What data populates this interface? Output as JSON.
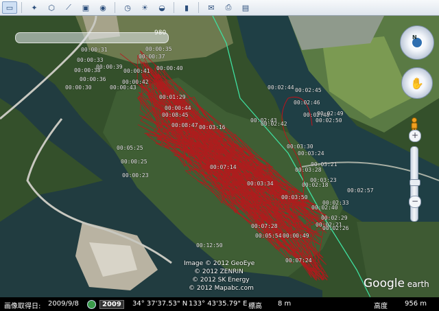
{
  "toolbar": {
    "buttons": [
      {
        "name": "sidebar-toggle",
        "icon": "sidebar-icon",
        "glyph": "▭",
        "active": true
      },
      {
        "name": "add-placemark",
        "icon": "pushpin-icon",
        "glyph": "✦"
      },
      {
        "name": "add-polygon",
        "icon": "polygon-icon",
        "glyph": "⬡"
      },
      {
        "name": "add-path",
        "icon": "path-icon",
        "glyph": "⟋"
      },
      {
        "name": "add-image-overlay",
        "icon": "overlay-icon",
        "glyph": "▣"
      },
      {
        "name": "record-tour",
        "icon": "camera-icon",
        "glyph": "◉"
      },
      {
        "name": "historical-imagery",
        "icon": "clock-icon",
        "glyph": "◷"
      },
      {
        "name": "sunlight",
        "icon": "sun-icon",
        "glyph": "☀"
      },
      {
        "name": "switch-planet",
        "icon": "planet-icon",
        "glyph": "◒"
      },
      {
        "name": "ruler",
        "icon": "ruler-icon",
        "glyph": "▮"
      },
      {
        "name": "email",
        "icon": "email-icon",
        "glyph": "✉"
      },
      {
        "name": "print",
        "icon": "print-icon",
        "glyph": "⎙"
      },
      {
        "name": "save-image",
        "icon": "image-icon",
        "glyph": "▤"
      }
    ]
  },
  "map": {
    "scale_value": "980",
    "track_labels": [
      "00:00:31",
      "00:00:35",
      "00:00:33",
      "00:00:37",
      "00:00:39",
      "00:00:38",
      "00:00:41",
      "00:00:40",
      "00:00:36",
      "00:00:42",
      "00:01:29",
      "00:00:30",
      "00:00:43",
      "00:00:44",
      "00:08:45",
      "00:08:47",
      "00:03:16",
      "00:02:43",
      "00:02:42",
      "00:02:44",
      "00:02:45",
      "00:02:46",
      "00:02:48",
      "00:02:49",
      "00:02:50",
      "00:05:25",
      "00:03:30",
      "00:03:24",
      "00:03:21",
      "00:03:28",
      "00:03:23",
      "00:02:57",
      "00:02:33",
      "00:02:29",
      "00:02:26",
      "00:02:21",
      "00:00:25",
      "00:00:23",
      "00:07:14",
      "00:07:28",
      "00:05:54",
      "00:00:49",
      "00:12:50",
      "00:03:34",
      "00:07:24",
      "00:02:18",
      "00:03:50",
      "00:02:40"
    ],
    "credits": [
      "Image © 2012 GeoEye",
      "© 2012 ZENRIN",
      "© 2012 SK Energy",
      "© 2012 Mapabc.com"
    ],
    "logo_main": "Google",
    "logo_sub": " earth",
    "compass_label": "N"
  },
  "status_bar": {
    "imagery_date_label": "画像取得日:",
    "imagery_date": "2009/9/8",
    "year": "2009",
    "latitude": "34° 37'37.53\" N",
    "longitude": "133° 43'35.79\" E",
    "elevation_label": "標高",
    "elevation": "8 m",
    "altitude_label": "高度",
    "altitude": "956 m"
  }
}
